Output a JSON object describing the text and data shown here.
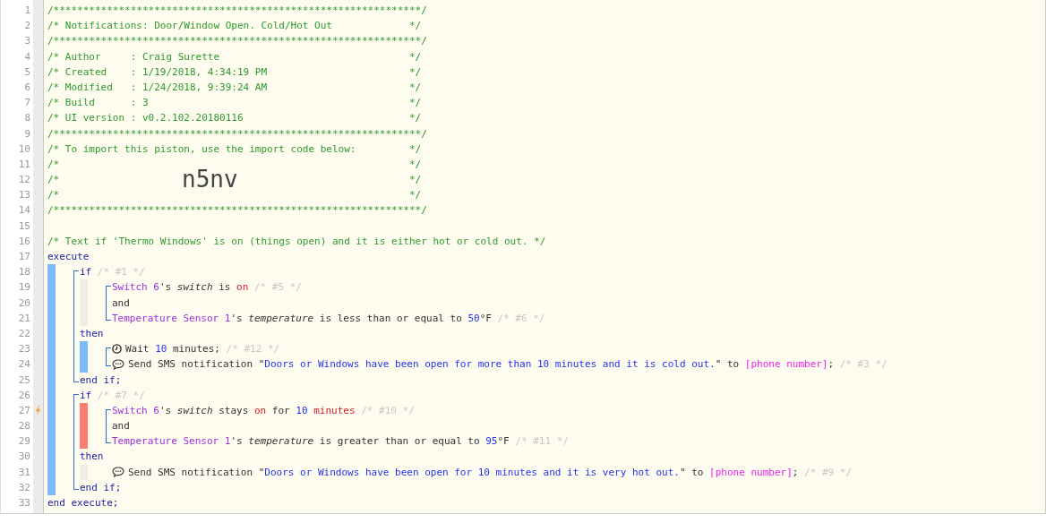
{
  "lines": [
    {
      "number": "1",
      "kind": "rule",
      "text": "/**************************************************************/"
    },
    {
      "number": "2",
      "kind": "box",
      "text": "/* Notifications: Door/Window Open. Cold/Hot Out",
      "end": "*/"
    },
    {
      "number": "3",
      "kind": "rule",
      "text": "/**************************************************************/"
    },
    {
      "number": "4",
      "kind": "box",
      "text": "/* Author     : Craig Surette",
      "end": "*/"
    },
    {
      "number": "5",
      "kind": "box",
      "text": "/* Created    : 1/19/2018, 4:34:19 PM",
      "end": "*/"
    },
    {
      "number": "6",
      "kind": "box",
      "text": "/* Modified   : 1/24/2018, 9:39:24 AM",
      "end": "*/"
    },
    {
      "number": "7",
      "kind": "box",
      "text": "/* Build      : 3",
      "end": "*/"
    },
    {
      "number": "8",
      "kind": "box",
      "text": "/* UI version : v0.2.102.20180116",
      "end": "*/"
    },
    {
      "number": "9",
      "kind": "rule",
      "text": "/**************************************************************/"
    },
    {
      "number": "10",
      "kind": "box",
      "text": "/* To import this piston, use the import code below:",
      "end": "*/"
    },
    {
      "number": "11",
      "kind": "box",
      "text": "/*",
      "end": "*/"
    },
    {
      "number": "12",
      "kind": "import",
      "text": "/*",
      "code": "n5nv",
      "end": "*/"
    },
    {
      "number": "13",
      "kind": "box",
      "text": "/*",
      "end": "*/"
    },
    {
      "number": "14",
      "kind": "rule",
      "text": "/**************************************************************/"
    },
    {
      "number": "15",
      "kind": "blank"
    },
    {
      "number": "16",
      "kind": "top",
      "tokens": [
        {
          "text": "/* Text if 'Thermo Windows' is on (things open) and it is either hot or cold out. */",
          "kind": "comment"
        }
      ]
    },
    {
      "number": "17",
      "kind": "top",
      "tokens": [
        {
          "text": "execute",
          "kind": "keyword"
        }
      ]
    },
    {
      "number": "18",
      "kind": "open",
      "tokens": [
        {
          "text": "if",
          "kind": "keyword"
        },
        {
          "text": " /* #1 */",
          "kind": "note"
        }
      ]
    },
    {
      "number": "19",
      "kind": "condition",
      "color": "#efede6",
      "tokens": [
        {
          "text": "Switch 6",
          "kind": "device"
        },
        {
          "text": "'s ",
          "kind": "plain"
        },
        {
          "text": "switch",
          "kind": "attribute"
        },
        {
          "text": " is ",
          "kind": "plain"
        },
        {
          "text": "on",
          "kind": "value"
        },
        {
          "text": " /* #5 */",
          "kind": "note"
        }
      ]
    },
    {
      "number": "20",
      "kind": "operator",
      "color": "#efede6",
      "tokens": [
        {
          "text": "and",
          "kind": "plain"
        }
      ]
    },
    {
      "number": "21",
      "kind": "condition",
      "color": "#efede6",
      "tokens": [
        {
          "text": "Temperature Sensor 1",
          "kind": "device"
        },
        {
          "text": "'s ",
          "kind": "plain"
        },
        {
          "text": "temperature",
          "kind": "attribute"
        },
        {
          "text": " is less than or equal to ",
          "kind": "plain"
        },
        {
          "text": "50",
          "kind": "number"
        },
        {
          "text": "°F ",
          "kind": "plain"
        },
        {
          "text": "/* #6 */",
          "kind": "note"
        }
      ]
    },
    {
      "number": "22",
      "kind": "middle",
      "tokens": [
        {
          "text": "then",
          "kind": "keyword"
        }
      ]
    },
    {
      "number": "23",
      "kind": "wait",
      "color": "#7dbbf7",
      "tokens": [
        {
          "text": "Wait ",
          "kind": "plain"
        },
        {
          "text": "10",
          "kind": "number"
        },
        {
          "text": " minutes; ",
          "kind": "plain"
        },
        {
          "text": "/* #12 */",
          "kind": "note"
        }
      ]
    },
    {
      "number": "24",
      "kind": "notify",
      "color": "#7dbbf7",
      "tokens": [
        {
          "text": "Send SMS notification \"",
          "kind": "plain"
        },
        {
          "text": "Doors or Windows have been open for more than 10 minutes and it is cold out.",
          "kind": "string"
        },
        {
          "text": "\" to ",
          "kind": "plain"
        },
        {
          "text": "[phone number]",
          "kind": "variable"
        },
        {
          "text": "; ",
          "kind": "plain"
        },
        {
          "text": "/* #3 */",
          "kind": "note"
        }
      ]
    },
    {
      "number": "25",
      "kind": "close",
      "tokens": [
        {
          "text": "end if;",
          "kind": "keyword"
        }
      ]
    },
    {
      "number": "26",
      "kind": "open",
      "tokens": [
        {
          "text": "if",
          "kind": "keyword"
        },
        {
          "text": " /* #7 */",
          "kind": "note"
        }
      ]
    },
    {
      "number": "27",
      "kind": "condition",
      "color": "#f77f72",
      "trigger": true,
      "tokens": [
        {
          "text": "Switch 6",
          "kind": "device"
        },
        {
          "text": "'s ",
          "kind": "plain"
        },
        {
          "text": "switch",
          "kind": "attribute"
        },
        {
          "text": " stays ",
          "kind": "plain"
        },
        {
          "text": "on",
          "kind": "value"
        },
        {
          "text": " for ",
          "kind": "plain"
        },
        {
          "text": "10",
          "kind": "number"
        },
        {
          "text": " minutes",
          "kind": "value"
        },
        {
          "text": " /* #10 */",
          "kind": "note"
        }
      ]
    },
    {
      "number": "28",
      "kind": "operator",
      "color": "#f77f72",
      "tokens": [
        {
          "text": "and",
          "kind": "plain"
        }
      ]
    },
    {
      "number": "29",
      "kind": "condition",
      "color": "#f77f72",
      "tokens": [
        {
          "text": "Temperature Sensor 1",
          "kind": "device"
        },
        {
          "text": "'s ",
          "kind": "plain"
        },
        {
          "text": "temperature",
          "kind": "attribute"
        },
        {
          "text": " is greater than or equal to ",
          "kind": "plain"
        },
        {
          "text": "95",
          "kind": "number"
        },
        {
          "text": "°F ",
          "kind": "plain"
        },
        {
          "text": "/* #11 */",
          "kind": "note"
        }
      ]
    },
    {
      "number": "30",
      "kind": "middle",
      "tokens": [
        {
          "text": "then",
          "kind": "keyword"
        }
      ]
    },
    {
      "number": "31",
      "kind": "notify",
      "color": "#efede6",
      "tokens": [
        {
          "text": "Send SMS notification \"",
          "kind": "plain"
        },
        {
          "text": "Doors or Windows have been open for 10 minutes and it is very hot out.",
          "kind": "string"
        },
        {
          "text": "\" to ",
          "kind": "plain"
        },
        {
          "text": "[phone number]",
          "kind": "variable"
        },
        {
          "text": "; ",
          "kind": "plain"
        },
        {
          "text": "/* #9 */",
          "kind": "note"
        }
      ]
    },
    {
      "number": "32",
      "kind": "close",
      "tokens": [
        {
          "text": "end if;",
          "kind": "keyword"
        }
      ]
    },
    {
      "number": "33",
      "kind": "top",
      "tokens": [
        {
          "text": "end execute;",
          "kind": "keyword"
        }
      ]
    }
  ]
}
